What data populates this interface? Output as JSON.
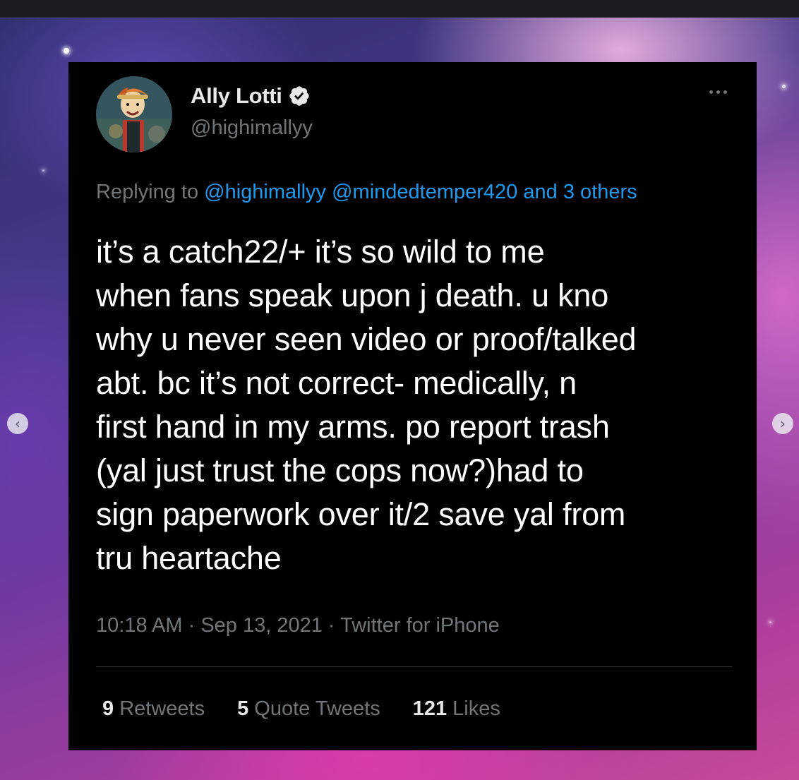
{
  "tweet": {
    "display_name": "Ally Lotti",
    "handle": "@highimallyy",
    "verified": true,
    "replying_prefix": "Replying to",
    "reply_mentions": [
      "@highimallyy",
      "@mindedtemper420"
    ],
    "reply_others": "and 3 others",
    "text": "it’s a catch22/+ it’s so wild to me\nwhen fans speak upon j death. u kno\nwhy u never seen video or proof/talked\nabt. bc it’s not correct- medically, n\nfirst hand in my arms. po report trash\n(yal just trust the cops now?)had to\nsign paperwork over it/2 save yal from\ntru heartache",
    "time": "10:18 AM",
    "date": "Sep 13, 2021",
    "source": "Twitter for iPhone",
    "separator": " · ",
    "stats": {
      "retweets_count": "9",
      "retweets_label": "Retweets",
      "quotes_count": "5",
      "quotes_label": "Quote Tweets",
      "likes_count": "121",
      "likes_label": "Likes"
    }
  },
  "carousel": {
    "prev_icon": "‹",
    "next_icon": "›"
  },
  "icons": {
    "verified": "verified-badge-icon",
    "more": "more-horizontal-icon"
  },
  "colors": {
    "tweet_background": "#000000",
    "text_primary": "#e7e9ea",
    "text_secondary": "#71767b",
    "link": "#1d9bf0",
    "divider": "#2f3336"
  }
}
